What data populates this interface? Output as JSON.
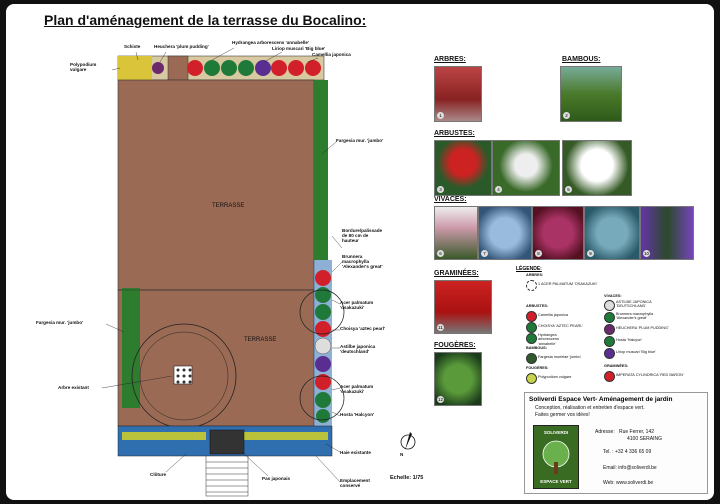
{
  "title": "Plan d'aménagement de la terrasse du Bocalino:",
  "plan": {
    "terrasse_label": "TERRASSE",
    "scale": "Echelle: 1/75",
    "compass": "N",
    "labels": {
      "schiste": "Schiste",
      "heuchera": "Heuchera 'plum pudding'",
      "hydrangea": "Hydrangea arborescens 'annabelle'",
      "liriope": "Liriop muscari 'Big blue'",
      "camellia": "Camellia japonica",
      "polypodium": "Polypodium vulgare",
      "fargesia_top": "Fargesia mur. 'jumbo'",
      "bordure": "Bordure/palissade de 80 cm de hauteur",
      "brunnera": "Brunnera macrophylla 'Alexander's great'",
      "acer1": "Acer palmatum 'osakazuki'",
      "choisya": "Choisya 'aztec pearl'",
      "astilbe": "Astilbe japonica 'deutschland'",
      "acer2": "Acer palmatum 'osakazuki'",
      "hosta": "Hosta 'Halcyon'",
      "fargesia_left": "Fargesia mur. 'jumbo'",
      "arbre": "Arbre existant",
      "haie": "Haie existante",
      "cloture": "Clôture",
      "pas": "Pas japonais",
      "empl": "Emplacement conservé"
    }
  },
  "catalog": {
    "arbres": "ARBRES:",
    "bambous": "BAMBOUS:",
    "arbustes": "ARBUSTES:",
    "vivaces": "VIVACES:",
    "graminees": "GRAMINÉES:",
    "fougeres": "FOUGÈRES:",
    "numbers": [
      "1",
      "2",
      "3",
      "4",
      "5",
      "6",
      "7",
      "8",
      "9",
      "10",
      "11",
      "12"
    ]
  },
  "legend": {
    "title": "LÉGENDE:",
    "arbres_h": "ARBRES:",
    "arbres_item": "1 ACER PALMATUM 'OSAKAZUKI'",
    "arbustes_h": "ARBUSTES:",
    "arbustes": [
      "Camellia japonica",
      "CHOISYA 'AZTEC PEARL'",
      "Hydrangea arborescens 'annabelle'"
    ],
    "bambous_h": "BAMBOUS:",
    "bambous": [
      "Fargesia murielae 'jumbo'"
    ],
    "fougeres_h": "FOUGÈRES:",
    "fougeres": [
      "Polypodium vulgare"
    ],
    "vivaces_h": "VIVACES:",
    "vivaces": [
      "ASTILBE JAPONICA 'DEUTSCHLAND'",
      "Brunnera macrophylla 'Alexander's great'",
      "HEUCHERA 'PLUM PUDDING'",
      "Hosta 'Halcyon'",
      "Liriop muscari 'Big blue'"
    ],
    "graminees_h": "GRAMINÉES:",
    "graminees": [
      "IMPERATA CYLINDRICA 'RED BARON'"
    ]
  },
  "company": {
    "name": "Soliverdi Espace Vert- Aménagement de jardin",
    "line1": "Conception, réalisation et entretien d'espace vert.",
    "line2": "Faites germer vos idées!",
    "addr_label": "Adresse:",
    "addr1": "Rue Ferrer, 142",
    "addr2": "4100 SERAING",
    "tel": "Tel. : +32 4 336 65 09",
    "email": "Email: info@soliverdi.be",
    "web": "Web: www.soliverdi.be",
    "logo_top": "SOLIVERDI",
    "logo_bottom": "ESPACE VERT"
  },
  "colors": {
    "terrace": "#9b6a55",
    "green": "#2e7d2e",
    "red": "#d2202a",
    "purple": "#5a2d91",
    "blue_border": "#2f6fb0"
  }
}
